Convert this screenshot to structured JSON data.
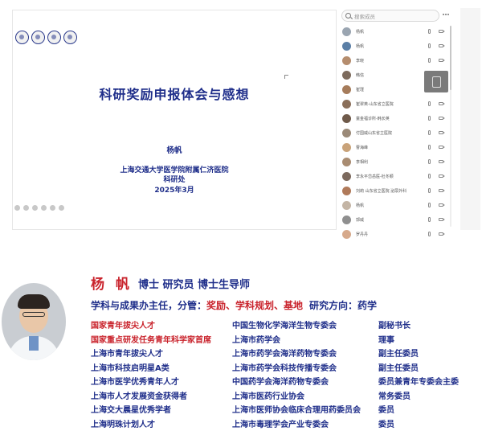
{
  "slide": {
    "title": "科研奖励申报体会与感想",
    "speaker": "杨帆",
    "institution": "上海交通大学医学院附属仁济医院",
    "department": "科研处",
    "date": "2025年3月"
  },
  "participants_panel": {
    "search_placeholder": "搜索成员",
    "members": [
      {
        "name": "杨帆",
        "color": "#9aa5b1"
      },
      {
        "name": "杨帆",
        "color": "#5b7fa6"
      },
      {
        "name": "李晓",
        "color": "#b58d6e"
      },
      {
        "name": "韩信",
        "color": "#7d6b5d"
      },
      {
        "name": "崔瑾",
        "color": "#a67c5b"
      },
      {
        "name": "崔翠英-山东省立医院",
        "color": "#8a6f5a"
      },
      {
        "name": "童金福诊所-韩长英",
        "color": "#6f5a4a"
      },
      {
        "name": "付国威山东省立医院",
        "color": "#9b8a78"
      },
      {
        "name": "曹海峰",
        "color": "#c9a37a"
      },
      {
        "name": "李相利",
        "color": "#a98c72"
      },
      {
        "name": "李永平岱岳医-杜冬颖",
        "color": "#7c6a5e"
      },
      {
        "name": "刘莉 山东省立医院 泌尿外科",
        "color": "#b07a5a"
      },
      {
        "name": "杨帆",
        "color": "#c4b5a5"
      },
      {
        "name": "郭威",
        "color": "#8f8f8f"
      },
      {
        "name": "罗丹丹",
        "color": "#d6a98b"
      }
    ]
  },
  "bio": {
    "name": "杨 帆",
    "titles": "博士 研究员 博士生导师",
    "position_prefix": "学科与成果办主任，分管：",
    "position_highlight": "奖励、学科规划、基地",
    "research_label": "研究方向：药学",
    "honors": [
      {
        "text": "国家青年拔尖人才",
        "highlight": true
      },
      {
        "text": "国家重点研发任务青年科学家首席",
        "highlight": true
      },
      {
        "text": "上海市青年拔尖人才",
        "highlight": false
      },
      {
        "text": "上海市科技启明星A类",
        "highlight": false
      },
      {
        "text": "上海市医学优秀青年人才",
        "highlight": false
      },
      {
        "text": "上海市人才发展资金获得者",
        "highlight": false
      },
      {
        "text": "上海交大晨星优秀学者",
        "highlight": false
      },
      {
        "text": "上海明珠计划人才",
        "highlight": false
      }
    ],
    "organizations": [
      "中国生物化学海洋生物专委会",
      "上海市药学会",
      "上海市药学会海洋药物专委会",
      "上海市药学会科技传播专委会",
      "中国药学会海洋药物专委会",
      "上海市医药行业协会",
      "上海市医师协会临床合理用药委员会",
      "上海市毒理学会产业专委会"
    ],
    "roles": [
      "副秘书长",
      "理事",
      "副主任委员",
      "副主任委员",
      "委员兼青年专委会主委",
      "常务委员",
      "委员",
      "委员"
    ]
  }
}
